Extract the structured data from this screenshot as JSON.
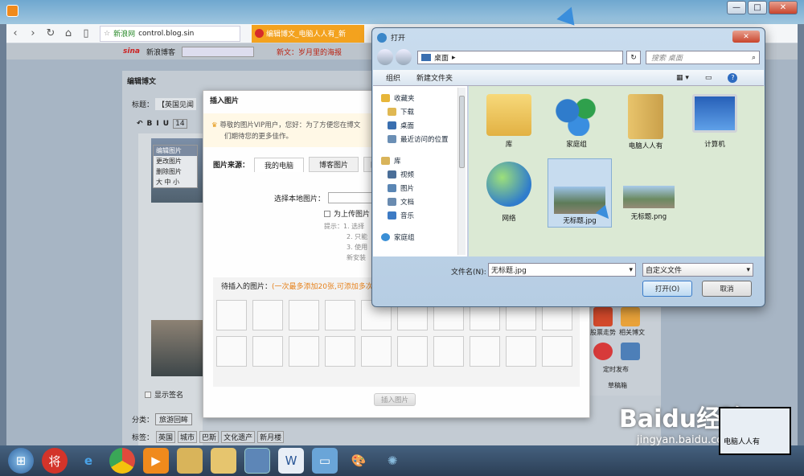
{
  "browser": {
    "address": "control.blog.sin",
    "bookmark": "新浪网",
    "tab_title": "编辑博文_电脑人人有_新",
    "sina_title": "新浪博客",
    "sina_marquee": "新文：岁月里的海报",
    "win_controls": [
      "—",
      "□",
      "✕"
    ]
  },
  "editor": {
    "panel_title": "编辑博文",
    "title_label": "标题：",
    "title_value": "【英国见闻",
    "toolbar": [
      "B",
      "I",
      "U",
      "14"
    ],
    "context_menu": [
      "编辑图片",
      "更改图片",
      "删除图片",
      "大 中 小"
    ],
    "show_sig": "显示签名",
    "category_label": "分类：",
    "category_value": "旅游回眸",
    "tags_label": "标签：",
    "tags": [
      "英国",
      "城市",
      "巴斯",
      "文化遗产",
      "新月楼"
    ],
    "side_tools": [
      "股票走势",
      "相关博文",
      "定时发布",
      "草稿箱"
    ]
  },
  "insert_dialog": {
    "title": "插入图片",
    "vip_notice": "尊敬的图片VIP用户，您好：为了方便您在博文",
    "vip_notice_2": "们期待您的更多佳作。",
    "source_label": "图片来源：",
    "tabs": [
      "我的电脑",
      "博客图片",
      "网"
    ],
    "choose_label": "选择本地图片：",
    "watermark_check": "为上传图片",
    "tips": [
      "提示：1. 选择",
      "2. 只能",
      "3. 使用",
      "新安装"
    ],
    "pending_label": "待插入的图片：",
    "pending_hint": "(一次最多添加20张,可添加多次)",
    "insert_button": "插入图片"
  },
  "open_dialog": {
    "title": "打开",
    "location": "桌面",
    "search_placeholder": "搜索 桌面",
    "organize": "组织",
    "new_folder": "新建文件夹",
    "tree": [
      {
        "label": "收藏夹",
        "icon": "star-icon",
        "color": "#e7b63a"
      },
      {
        "label": "下载",
        "icon": "download-folder-icon",
        "color": "#e0b853"
      },
      {
        "label": "桌面",
        "icon": "desktop-icon",
        "color": "#3a6fb0"
      },
      {
        "label": "最近访问的位置",
        "icon": "recent-places-icon",
        "color": "#6b8fb5"
      },
      {
        "label": "库",
        "icon": "library-icon",
        "color": "#d9b45a"
      },
      {
        "label": "视频",
        "icon": "video-icon",
        "color": "#4a6e98"
      },
      {
        "label": "图片",
        "icon": "pictures-icon",
        "color": "#5a86b4"
      },
      {
        "label": "文档",
        "icon": "documents-icon",
        "color": "#6a8bb0"
      },
      {
        "label": "音乐",
        "icon": "music-icon",
        "color": "#3d7bc4"
      },
      {
        "label": "家庭组",
        "icon": "homegroup-icon",
        "color": "#3a8fd6"
      }
    ],
    "files": [
      {
        "label": "库",
        "icon": "library-folder-icon"
      },
      {
        "label": "家庭组",
        "icon": "homegroup-icon"
      },
      {
        "label": "电脑人人有",
        "icon": "user-folder-icon"
      },
      {
        "label": "计算机",
        "icon": "computer-icon"
      },
      {
        "label": "网络",
        "icon": "network-icon"
      },
      {
        "label": "无标题.jpg",
        "icon": "jpg-thumbnail-icon"
      },
      {
        "label": "无标题.png",
        "icon": "png-thumbnail-icon"
      }
    ],
    "filename_label": "文件名(N):",
    "filename_value": "无标题.jpg",
    "filter_value": "自定义文件",
    "open_button": "打开(O)",
    "cancel_button": "取消"
  },
  "watermark": {
    "brand": "Baidu经验",
    "url": "jingyan.baidu.com",
    "tv_text": "电脑人人有"
  },
  "taskbar": [
    "windows-start",
    "jiang-app",
    "ie",
    "chrome",
    "media-player",
    "explorer",
    "folder",
    "qq-browser",
    "word",
    "remote-desktop",
    "paint",
    "pinwheel"
  ]
}
